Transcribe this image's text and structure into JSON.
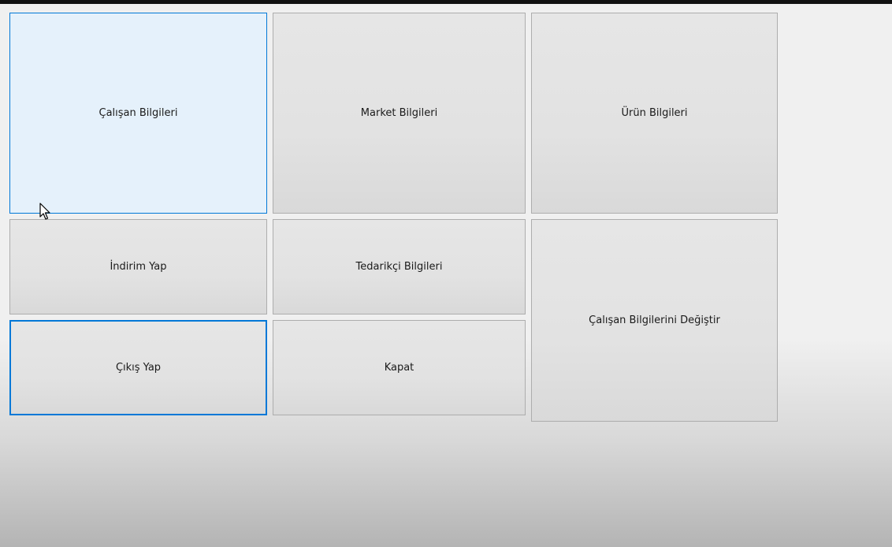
{
  "buttons": {
    "calisan_bilgileri": "Çalışan Bilgileri",
    "market_bilgileri": "Market Bilgileri",
    "urun_bilgileri": "Ürün Bilgileri",
    "indirim_yap": "İndirim Yap",
    "tedarikci_bilgileri": "Tedarikçi Bilgileri",
    "calisan_bilgilerini_degistir": "Çalışan Bilgilerini Değiştir",
    "cikis_yap": "Çıkış Yap",
    "kapat": "Kapat"
  },
  "cursor_icon": "mouse-pointer-icon",
  "colors": {
    "hover_bg": "#e5f1fb",
    "focus_border": "#0078d7",
    "button_bg": "#e1e1e1"
  }
}
